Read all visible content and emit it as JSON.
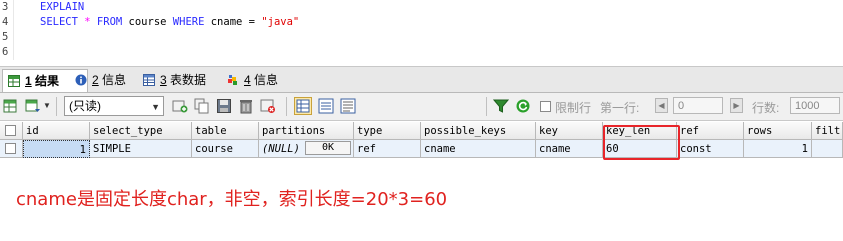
{
  "editor": {
    "lines": [
      {
        "num": "3",
        "tokens": [
          {
            "t": "EXPLAIN",
            "c": "kw"
          }
        ]
      },
      {
        "num": "4",
        "tokens": [
          {
            "t": "SELECT",
            "c": "kw"
          },
          {
            "t": " ",
            "c": "plain"
          },
          {
            "t": "*",
            "c": "star"
          },
          {
            "t": " ",
            "c": "plain"
          },
          {
            "t": "FROM",
            "c": "kw"
          },
          {
            "t": " course ",
            "c": "plain"
          },
          {
            "t": "WHERE",
            "c": "kw"
          },
          {
            "t": " cname ",
            "c": "plain"
          },
          {
            "t": "=",
            "c": "op"
          },
          {
            "t": " ",
            "c": "plain"
          },
          {
            "t": "\"java\"",
            "c": "str"
          }
        ]
      },
      {
        "num": "5",
        "tokens": []
      },
      {
        "num": "6",
        "tokens": []
      }
    ]
  },
  "tabs": [
    {
      "num": "1",
      "label": "结果",
      "icon": "result-grid-icon",
      "active": true
    },
    {
      "num": "2",
      "label": "信息",
      "icon": "info-icon",
      "active": false
    },
    {
      "num": "3",
      "label": "表数据",
      "icon": "table-data-icon",
      "active": false
    },
    {
      "num": "4",
      "label": "信息",
      "icon": "multi-info-icon",
      "active": false
    }
  ],
  "toolbar": {
    "mode_select": "(只读)",
    "limit_rows_label": "限制行",
    "first_row_label": "第一行:",
    "first_row_value": "0",
    "rows_label": "行数:",
    "rows_value": "1000"
  },
  "grid": {
    "columns": [
      "id",
      "select_type",
      "table",
      "partitions",
      "type",
      "possible_keys",
      "key",
      "key_len",
      "ref",
      "rows",
      "filt"
    ],
    "row": {
      "id": "1",
      "select_type": "SIMPLE",
      "table": "course",
      "partitions": "(NULL)",
      "partitions_btn": "0K",
      "type": "ref",
      "possible_keys": "cname",
      "key": "cname",
      "key_len": "60",
      "ref": "const",
      "rows": "1",
      "filt": ""
    },
    "highlight_color": "#e8252a"
  },
  "annotation": {
    "text": "cname是固定长度char，非空，索引长度=20*3=60",
    "color": "#e0221f"
  }
}
